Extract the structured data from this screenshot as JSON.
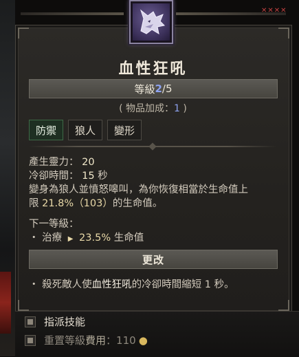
{
  "skill": {
    "icon": "wolf-head-icon",
    "title": "血性狂吼",
    "rank_label": "等級 ",
    "rank_current": "2",
    "rank_max": "/5",
    "item_bonus_prefix": "( 物品加成：",
    "item_bonus_value": "1",
    "item_bonus_suffix": " )",
    "tags": [
      "防禦",
      "狼人",
      "變形"
    ],
    "active_tag": "防禦"
  },
  "stats": {
    "spirit_label": "產生靈力：",
    "spirit_value": "20",
    "cooldown_label": "冷卻時間：",
    "cooldown_value": "15",
    "cooldown_unit": "秒",
    "desc_line1": "變身為狼人並憤怒嗥叫，為你恢復相當於生命值上",
    "desc_line2_pre": "限 ",
    "desc_pct": "21.8%",
    "desc_paren": "（103）",
    "desc_line2_post": "的生命值。"
  },
  "next_rank": {
    "label": "下一等級：",
    "bullet": "・",
    "stat": "治療",
    "value": "23.5%",
    "suffix": "生命值"
  },
  "modifier": {
    "button_label": "更改",
    "desc_pre": "・ 殺死敵人使",
    "desc_skill": "血性狂吼",
    "desc_post": "的冷卻時間縮短 1 秒。"
  },
  "actions": {
    "assign_label": "指派技能",
    "reset_label": "重置等級",
    "reset_cost_label": "費用",
    "reset_cost_sep": "：",
    "reset_cost_value": "110",
    "gold_icon": "gold-coin-icon",
    "key_icon": "mouse-button-icon"
  },
  "colors": {
    "rank_accent": "#8ea3f0",
    "highlight": "#e9d9a8",
    "active_tag_bg": "#1e2f22",
    "gold": "#d9b85e"
  }
}
